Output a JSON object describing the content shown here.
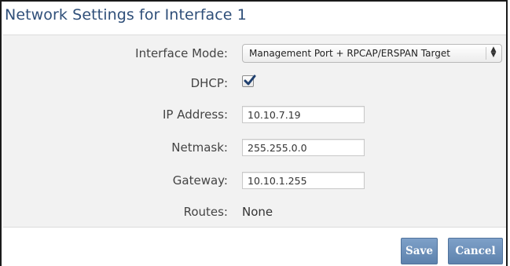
{
  "dialog": {
    "title": "Network Settings for Interface 1"
  },
  "form": {
    "interface_mode": {
      "label": "Interface Mode:",
      "selected": "Management Port + RPCAP/ERSPAN Target"
    },
    "dhcp": {
      "label": "DHCP:",
      "checked": true
    },
    "ip_address": {
      "label": "IP Address:",
      "value": "10.10.7.19"
    },
    "netmask": {
      "label": "Netmask:",
      "value": "255.255.0.0"
    },
    "gateway": {
      "label": "Gateway:",
      "value": "10.10.1.255"
    },
    "routes": {
      "label": "Routes:",
      "value": "None"
    }
  },
  "actions": {
    "save_label": "Save",
    "cancel_label": "Cancel"
  },
  "colors": {
    "title": "#2f4f79",
    "button": "#6b8db7",
    "panel_bg": "#f2f2f2"
  }
}
